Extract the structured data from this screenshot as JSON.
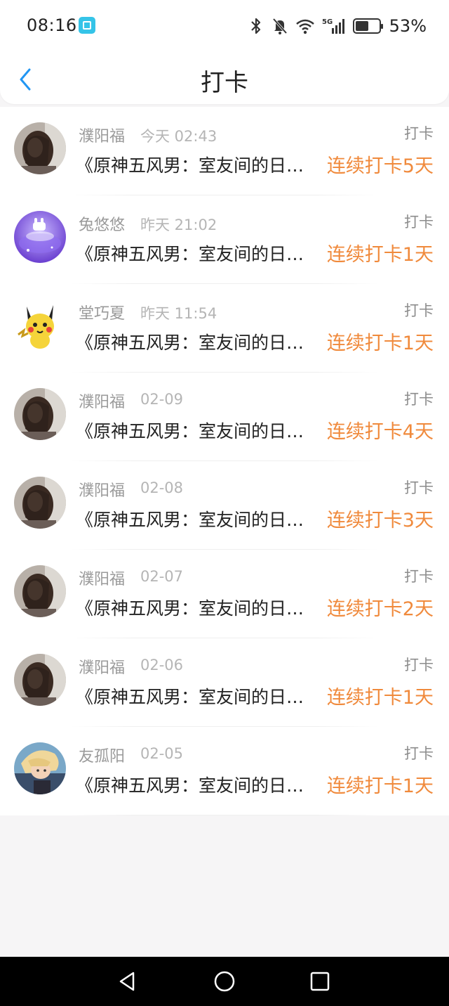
{
  "status_bar": {
    "time": "08:16",
    "battery": "53%",
    "icons": [
      "bluetooth-icon",
      "bell-muted-icon",
      "wifi-icon",
      "5g-signal-icon",
      "battery-icon"
    ]
  },
  "header": {
    "title": "打卡",
    "back_icon": "chevron-left-icon"
  },
  "colors": {
    "accent_blue": "#2196f3",
    "streak_orange": "#f08a3c",
    "background": "#f6f5f6"
  },
  "records": [
    {
      "name": "濮阳福",
      "date": "今天 02:43",
      "type": "打卡",
      "book": "《原神五风男：室友间的日常》",
      "streak": "连续打卡5天",
      "avatar": "girl-dark-hair"
    },
    {
      "name": "兔悠悠",
      "date": "昨天 21:02",
      "type": "打卡",
      "book": "《原神五风男：室友间的日常》",
      "streak": "连续打卡1天",
      "avatar": "purple-bunny"
    },
    {
      "name": "堂巧夏",
      "date": "昨天 11:54",
      "type": "打卡",
      "book": "《原神五风男：室友间的日常》",
      "streak": "连续打卡1天",
      "avatar": "pikachu"
    },
    {
      "name": "濮阳福",
      "date": "02-09",
      "type": "打卡",
      "book": "《原神五风男：室友间的日常》",
      "streak": "连续打卡4天",
      "avatar": "girl-dark-hair"
    },
    {
      "name": "濮阳福",
      "date": "02-08",
      "type": "打卡",
      "book": "《原神五风男：室友间的日常》",
      "streak": "连续打卡3天",
      "avatar": "girl-dark-hair"
    },
    {
      "name": "濮阳福",
      "date": "02-07",
      "type": "打卡",
      "book": "《原神五风男：室友间的日常》",
      "streak": "连续打卡2天",
      "avatar": "girl-dark-hair"
    },
    {
      "name": "濮阳福",
      "date": "02-06",
      "type": "打卡",
      "book": "《原神五风男：室友间的日常》",
      "streak": "连续打卡1天",
      "avatar": "girl-dark-hair"
    },
    {
      "name": "友孤阳",
      "date": "02-05",
      "type": "打卡",
      "book": "《原神五风男：室友间的日常》",
      "streak": "连续打卡1天",
      "avatar": "anime-blonde"
    }
  ],
  "nav_bar": {
    "buttons": [
      "back-triangle-icon",
      "home-circle-icon",
      "recents-square-icon"
    ]
  }
}
